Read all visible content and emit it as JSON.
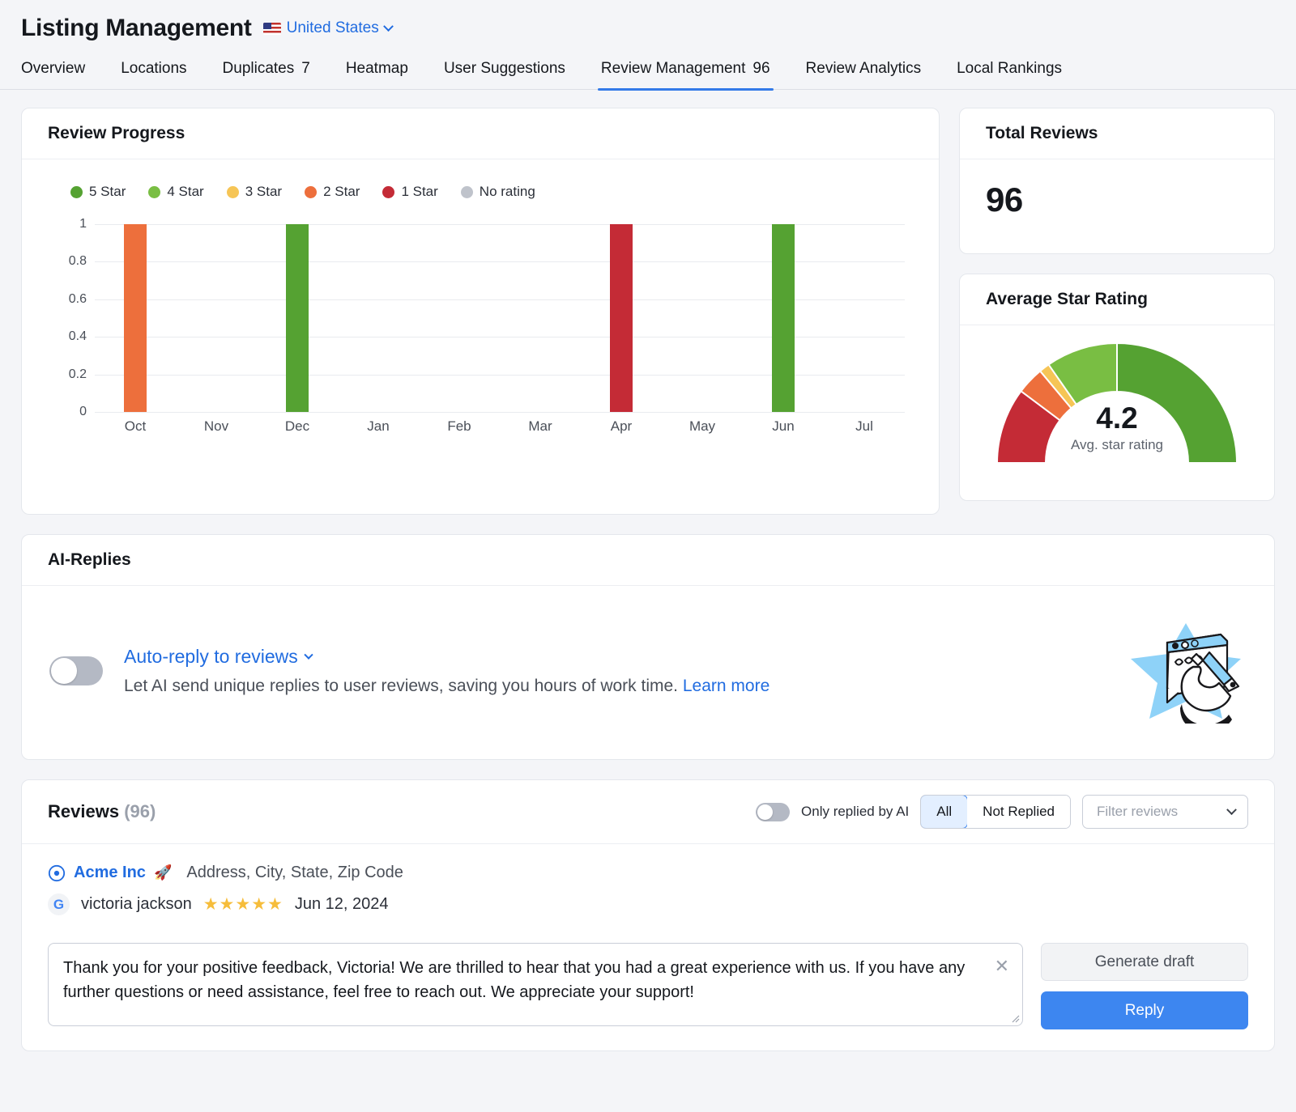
{
  "header": {
    "title": "Listing Management",
    "country": "United States",
    "flag_icon": "us-flag-icon",
    "caret_icon": "chevron-down-icon"
  },
  "tabs": [
    {
      "label": "Overview",
      "count": "",
      "active": false
    },
    {
      "label": "Locations",
      "count": "",
      "active": false
    },
    {
      "label": "Duplicates",
      "count": "7",
      "active": false
    },
    {
      "label": "Heatmap",
      "count": "",
      "active": false
    },
    {
      "label": "User Suggestions",
      "count": "",
      "active": false
    },
    {
      "label": "Review Management",
      "count": "96",
      "active": true
    },
    {
      "label": "Review Analytics",
      "count": "",
      "active": false
    },
    {
      "label": "Local Rankings",
      "count": "",
      "active": false
    }
  ],
  "review_progress": {
    "title": "Review Progress"
  },
  "chart_data": {
    "type": "bar",
    "title": "Review Progress",
    "xlabel": "",
    "ylabel": "",
    "ylim": [
      0,
      1
    ],
    "yticks": [
      "0",
      "0.2",
      "0.4",
      "0.6",
      "0.8",
      "1"
    ],
    "grid": true,
    "legend_position": "top-left",
    "legend": [
      {
        "label": "5 Star",
        "color": "#55a232"
      },
      {
        "label": "4 Star",
        "color": "#79be43"
      },
      {
        "label": "3 Star",
        "color": "#f6c556"
      },
      {
        "label": "2 Star",
        "color": "#ed6f3c"
      },
      {
        "label": "1 Star",
        "color": "#c42b36"
      },
      {
        "label": "No rating",
        "color": "#bfc3cb"
      }
    ],
    "categories": [
      "Oct",
      "Nov",
      "Dec",
      "Jan",
      "Feb",
      "Mar",
      "Apr",
      "May",
      "Jun",
      "Jul"
    ],
    "values": [
      1,
      0,
      1,
      0,
      0,
      0,
      1,
      0,
      1,
      0
    ],
    "bar_colors": [
      "#ed6f3c",
      "",
      "#55a232",
      "",
      "",
      "",
      "#c42b36",
      "",
      "#55a232",
      ""
    ],
    "series": [
      {
        "name": "5 Star",
        "values": [
          0,
          0,
          1,
          0,
          0,
          0,
          0,
          0,
          1,
          0
        ]
      },
      {
        "name": "4 Star",
        "values": [
          0,
          0,
          0,
          0,
          0,
          0,
          0,
          0,
          0,
          0
        ]
      },
      {
        "name": "3 Star",
        "values": [
          0,
          0,
          0,
          0,
          0,
          0,
          0,
          0,
          0,
          0
        ]
      },
      {
        "name": "2 Star",
        "values": [
          1,
          0,
          0,
          0,
          0,
          0,
          0,
          0,
          0,
          0
        ]
      },
      {
        "name": "1 Star",
        "values": [
          0,
          0,
          0,
          0,
          0,
          0,
          1,
          0,
          0,
          0
        ]
      },
      {
        "name": "No rating",
        "values": [
          0,
          0,
          0,
          0,
          0,
          0,
          0,
          0,
          0,
          0
        ]
      }
    ]
  },
  "total_reviews": {
    "title": "Total Reviews",
    "value": "96"
  },
  "average_rating": {
    "title": "Average Star Rating",
    "value": "4.2",
    "caption": "Avg. star rating",
    "gauge_segments": [
      {
        "name": "1 Star",
        "color": "#c42b36",
        "span_deg": 36
      },
      {
        "name": "2 Star",
        "color": "#ed6f3c",
        "span_deg": 13
      },
      {
        "name": "3 Star",
        "color": "#f6c556",
        "span_deg": 5
      },
      {
        "name": "4 Star",
        "color": "#79be43",
        "span_deg": 34
      },
      {
        "name": "5 Star",
        "color": "#55a232",
        "span_deg": 88
      }
    ]
  },
  "ai_replies": {
    "title": "AI-Replies",
    "toggle_on": false,
    "link": "Auto-reply to reviews",
    "description": "Let AI send unique replies to user reviews, saving you hours of work time.",
    "learn_more": "Learn more",
    "illustration": "hand-writing-reply-illustration"
  },
  "reviews": {
    "title": "Reviews",
    "count": "(96)",
    "only_ai_label": "Only replied by AI",
    "only_ai_toggle_on": false,
    "segments": [
      {
        "label": "All",
        "selected": true
      },
      {
        "label": "Not Replied",
        "selected": false
      }
    ],
    "filter_placeholder": "Filter reviews",
    "items": [
      {
        "business": "Acme Inc",
        "business_badge": "🚀",
        "address": "Address, City, State, Zip Code",
        "source_icon": "google-icon",
        "source_letter": "G",
        "author": "victoria jackson",
        "rating": 5,
        "stars": "★★★★★",
        "date": "Jun 12, 2024",
        "reply_text": "Thank you for your positive feedback, Victoria! We are thrilled to hear that you had a great experience with us. If you have any further questions or need assistance, feel free to reach out. We appreciate your support!",
        "clear_icon": "close-icon",
        "generate_label": "Generate draft",
        "reply_label": "Reply"
      }
    ]
  },
  "colors": {
    "accent_blue": "#3d86f0",
    "link_blue": "#216ce0",
    "page_bg": "#f4f5f8",
    "card_bg": "#ffffff"
  }
}
